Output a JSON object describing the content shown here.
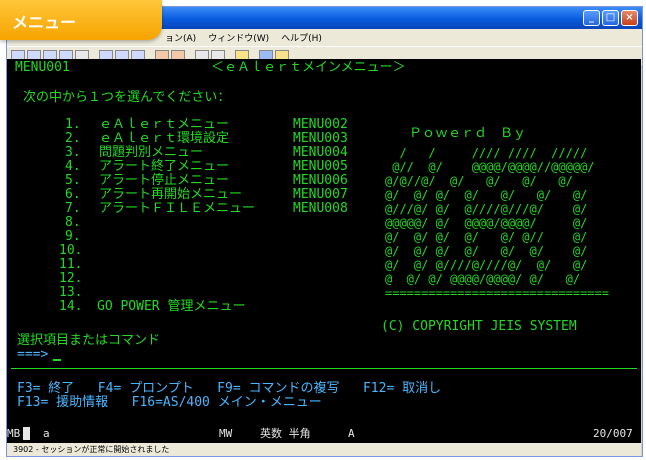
{
  "badge": {
    "label": "メニュー"
  },
  "menubar": {
    "items": [
      "ョン(A)",
      "ウィンドウ(W)",
      "ヘルプ(H)"
    ]
  },
  "screen": {
    "menu_id": "MENU001",
    "title": "＜ｅＡｌｅｒｔメインメニュー＞",
    "instruction": "次の中から１つを選んでください：",
    "options": [
      {
        "num": "1.",
        "label": "ｅＡｌｅｒｔメニュー",
        "code": "MENU002"
      },
      {
        "num": "2.",
        "label": "ｅＡｌｅｒｔ環境設定",
        "code": "MENU003"
      },
      {
        "num": "3.",
        "label": "問題判別メニュー",
        "code": "MENU004"
      },
      {
        "num": "4.",
        "label": "アラート終了メニュー",
        "code": "MENU005"
      },
      {
        "num": "5.",
        "label": "アラート停止メニュー",
        "code": "MENU006"
      },
      {
        "num": "6.",
        "label": "アラート再開始メニュー",
        "code": "MENU007"
      },
      {
        "num": "7.",
        "label": "アラートＦＩＬＥメニュー",
        "code": "MENU008"
      },
      {
        "num": "8.",
        "label": "",
        "code": ""
      },
      {
        "num": "9.",
        "label": "",
        "code": ""
      },
      {
        "num": "10.",
        "label": "",
        "code": ""
      },
      {
        "num": "11.",
        "label": "",
        "code": ""
      },
      {
        "num": "12.",
        "label": "",
        "code": ""
      },
      {
        "num": "13.",
        "label": "",
        "code": ""
      },
      {
        "num": "14.",
        "label": "GO POWER 管理メニュー",
        "code": ""
      }
    ],
    "powered_by": "Ｐｏｗｅｒｄ　Ｂｙ",
    "logo_art": [
      "  /   /     //// ////  /////",
      " @//  @/    @@@@/@@@@//@@@@@/",
      "@/@//@/  @/   @/   @/   @/",
      "@/  @/ @/  @/   @/   @/   @/",
      "@///@/ @/  @////@///@/    @/",
      "@@@@@/ @/  @@@@/@@@@/     @/",
      "@/  @/ @/  @/   @/ @//    @/",
      "@/  @/ @/  @/   @/  @/    @/",
      "@/  @/ @////@////@/  @/   @/",
      "@  @/ @/ @@@@/@@@@/ @/   @/",
      "==============================="
    ],
    "copyright": "(C) COPYRIGHT JEIS SYSTEM",
    "command_prompt_label": "選択項目またはコマンド",
    "command_arrow": "===>",
    "fkeys_line1": "F3= 終了   F4= プロンプト   F9= コマンドの複写   F12= 取消し",
    "fkeys_line2": "F13= 援助情報   F16=AS/400 メイン・メニュー"
  },
  "oia": {
    "session": "MB",
    "mode": "a",
    "mw": "MW",
    "input_mode": "英数 半角",
    "keyboard": "A",
    "cursor_pos": "20/007"
  },
  "statusbar": {
    "message": "3902 - セッションが正常に開始されました"
  },
  "colors": {
    "screen_bg": "#000000",
    "green": "#23d923",
    "blue": "#4ab6ff",
    "badge": "#f7a400"
  }
}
